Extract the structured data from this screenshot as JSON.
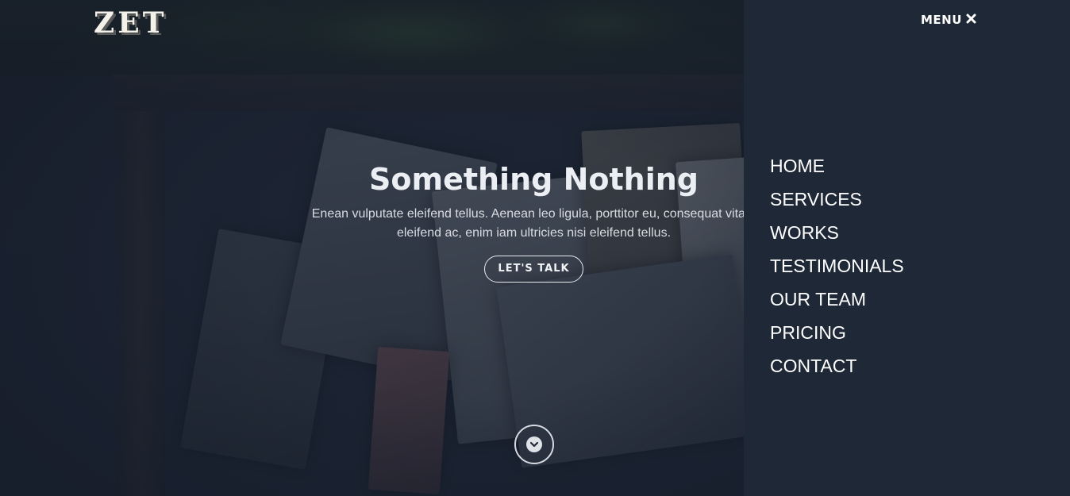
{
  "brand": {
    "logo": "ZET"
  },
  "hero": {
    "title": "Something Nothing",
    "text_line1": "Enean vulputate eleifend tellus. Aenean leo ligula, porttitor eu, consequat vitae,",
    "text_line2": "eleifend ac, enim iam ultricies nisi eleifend tellus.",
    "cta_label": "LET'S TALK",
    "scroll_icon": "chevron-down-icon"
  },
  "menu": {
    "toggle_label": "MENU",
    "toggle_icon": "close-icon",
    "items": [
      {
        "label": "HOME"
      },
      {
        "label": "SERVICES"
      },
      {
        "label": "WORKS"
      },
      {
        "label": "TESTIMONIALS"
      },
      {
        "label": "OUR TEAM"
      },
      {
        "label": "PRICING"
      },
      {
        "label": "CONTACT"
      }
    ]
  },
  "colors": {
    "panel_bg": "#1f2837",
    "overlay": "#1c2434",
    "text": "#ffffff"
  }
}
